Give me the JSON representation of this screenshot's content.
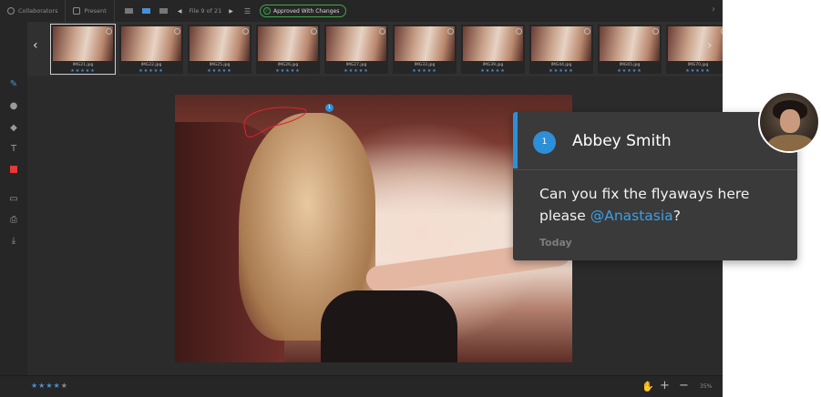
{
  "topbar": {
    "collaborators_label": "Collaborators",
    "present_label": "Present",
    "file_counter": "File 9 of 21",
    "approval_status": "Approved With Changes",
    "colors": {
      "approved": "#3fa64a",
      "accent": "#4a90d9"
    }
  },
  "filmstrip": {
    "thumbnails": [
      {
        "name": "IMG21.jpg",
        "stars": "★★★★★"
      },
      {
        "name": "IMG22.jpg",
        "stars": "★★★★★"
      },
      {
        "name": "IMG25.jpg",
        "stars": "★★★★★"
      },
      {
        "name": "IMG26.jpg",
        "stars": "★★★★★"
      },
      {
        "name": "IMG27.jpg",
        "stars": "★★★★★"
      },
      {
        "name": "IMG33.jpg",
        "stars": "★★★★★"
      },
      {
        "name": "IMG39.jpg",
        "stars": "★★★★★"
      },
      {
        "name": "IMG44.jpg",
        "stars": "★★★★★"
      },
      {
        "name": "IMG65.jpg",
        "stars": "★★★★★"
      },
      {
        "name": "IMG70.jpg",
        "stars": "★★★★★"
      }
    ]
  },
  "canvas": {
    "annotation_number": "1"
  },
  "bottombar": {
    "rating_on": "★★★★",
    "rating_off": "★",
    "zoom_level": "35%"
  },
  "comment": {
    "number": "1",
    "author": "Abbey Smith",
    "text_before": "Can you fix the flyaways here please ",
    "mention": "@Anastasia",
    "text_after": "?",
    "date": "Today",
    "accent_color": "#2d8fd8"
  }
}
